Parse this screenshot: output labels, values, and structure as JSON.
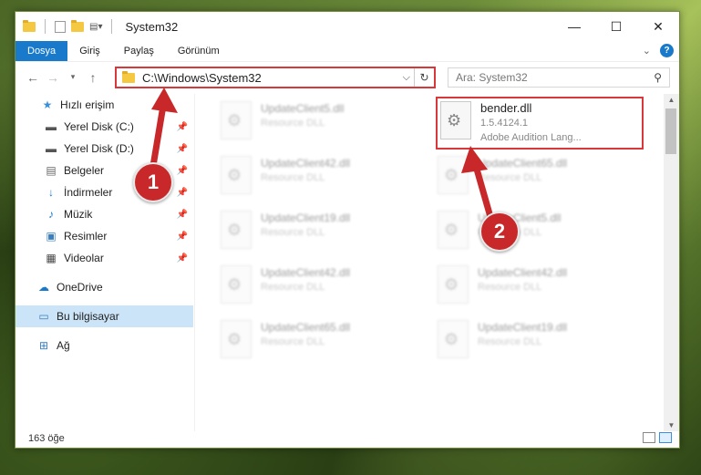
{
  "window": {
    "title": "System32",
    "controls": [
      "—",
      "☐",
      "✕"
    ]
  },
  "ribbon": {
    "tabs": [
      "Dosya",
      "Giriş",
      "Paylaş",
      "Görünüm"
    ],
    "active": "Dosya"
  },
  "nav": {
    "address": "C:\\Windows\\System32",
    "search_placeholder": "Ara: System32"
  },
  "sidebar": {
    "items": [
      {
        "label": "Hızlı erişim",
        "icon": "star-icon",
        "pinned": false
      },
      {
        "label": "Yerel Disk (C:)",
        "icon": "drive-icon",
        "pinned": true
      },
      {
        "label": "Yerel Disk (D:)",
        "icon": "drive-icon",
        "pinned": true
      },
      {
        "label": "Belgeler",
        "icon": "documents-icon",
        "pinned": true
      },
      {
        "label": "İndirmeler",
        "icon": "download-icon",
        "pinned": true
      },
      {
        "label": "Müzik",
        "icon": "music-icon",
        "pinned": true
      },
      {
        "label": "Resimler",
        "icon": "pictures-icon",
        "pinned": true
      },
      {
        "label": "Videolar",
        "icon": "videos-icon",
        "pinned": true
      },
      {
        "label": "OneDrive",
        "icon": "cloud-icon",
        "pinned": false
      },
      {
        "label": "Bu bilgisayar",
        "icon": "computer-icon",
        "pinned": false
      },
      {
        "label": "Ağ",
        "icon": "network-icon",
        "pinned": false
      }
    ]
  },
  "files": [
    {
      "name": "UpdateClient5.dll",
      "type": "Resource DLL"
    },
    {
      "name": "bender.dll",
      "version": "1.5.4124.1",
      "desc": "Adobe Audition Lang..."
    },
    {
      "name": "UpdateClient42.dll",
      "type": "Resource DLL"
    },
    {
      "name": "UpdateClient65.dll",
      "type": "Resource DLL"
    },
    {
      "name": "UpdateClient19.dll",
      "type": "Resource DLL"
    },
    {
      "name": "UpdateClient5.dll",
      "type": "Resource DLL"
    },
    {
      "name": "UpdateClient42.dll",
      "type": "Resource DLL"
    },
    {
      "name": "UpdateClient42.dll",
      "type": "Resource DLL"
    },
    {
      "name": "UpdateClient65.dll",
      "type": "Resource DLL"
    },
    {
      "name": "UpdateClient19.dll",
      "type": "Resource DLL"
    }
  ],
  "status": {
    "count": "163 öğe"
  },
  "callouts": [
    "1",
    "2"
  ],
  "colors": {
    "accent": "#1979ca",
    "highlight": "#d9383a",
    "selected": "#cce4f7"
  }
}
